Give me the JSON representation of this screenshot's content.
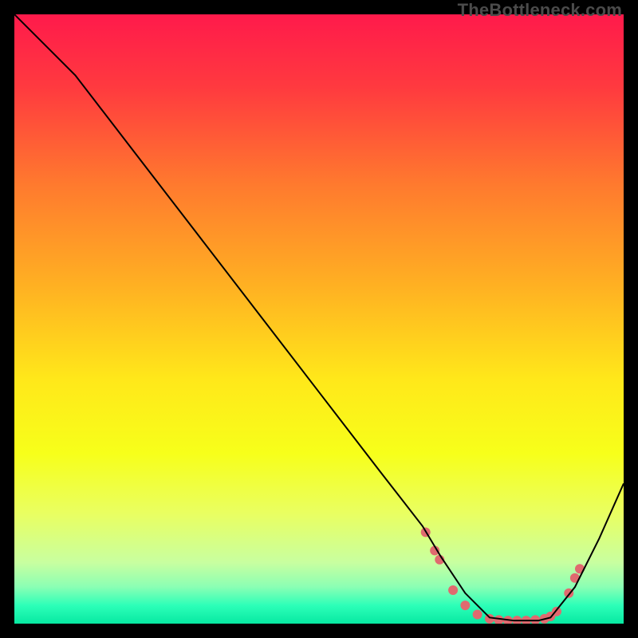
{
  "watermark": "TheBottleneck.com",
  "chart_data": {
    "type": "line",
    "title": "",
    "xlabel": "",
    "ylabel": "",
    "xlim": [
      0,
      100
    ],
    "ylim": [
      0,
      100
    ],
    "grid": false,
    "legend": false,
    "background_gradient_stops": [
      {
        "offset": 0.0,
        "color": "#ff1a4b"
      },
      {
        "offset": 0.12,
        "color": "#ff3a3f"
      },
      {
        "offset": 0.28,
        "color": "#ff7a2e"
      },
      {
        "offset": 0.45,
        "color": "#ffb222"
      },
      {
        "offset": 0.6,
        "color": "#ffe81a"
      },
      {
        "offset": 0.72,
        "color": "#f7ff1a"
      },
      {
        "offset": 0.82,
        "color": "#e9ff62"
      },
      {
        "offset": 0.9,
        "color": "#c8ffa0"
      },
      {
        "offset": 0.94,
        "color": "#8affb4"
      },
      {
        "offset": 0.97,
        "color": "#2dffb8"
      },
      {
        "offset": 1.0,
        "color": "#07e9a2"
      }
    ],
    "series": [
      {
        "name": "curve",
        "color": "#000000",
        "stroke_width": 2,
        "x": [
          0,
          6,
          10,
          20,
          30,
          40,
          50,
          60,
          67,
          70,
          74,
          78,
          82,
          86,
          88,
          92,
          96,
          100
        ],
        "y": [
          100,
          94,
          90,
          77,
          64,
          51,
          38,
          25,
          16,
          11,
          5,
          1,
          0.5,
          0.5,
          1,
          6,
          14,
          23
        ]
      }
    ],
    "markers": {
      "name": "dots",
      "color": "#e06a6f",
      "radius": 6,
      "x": [
        67.5,
        69.0,
        69.8,
        72.0,
        74.0,
        76.0,
        78.0,
        79.5,
        81.0,
        82.5,
        84.0,
        85.5,
        87.0,
        88.0,
        89.0,
        91.0,
        92.0,
        92.8
      ],
      "y": [
        15.0,
        12.0,
        10.5,
        5.5,
        3.0,
        1.5,
        0.8,
        0.6,
        0.5,
        0.5,
        0.5,
        0.6,
        0.8,
        1.2,
        2.0,
        5.0,
        7.5,
        9.0
      ]
    }
  }
}
